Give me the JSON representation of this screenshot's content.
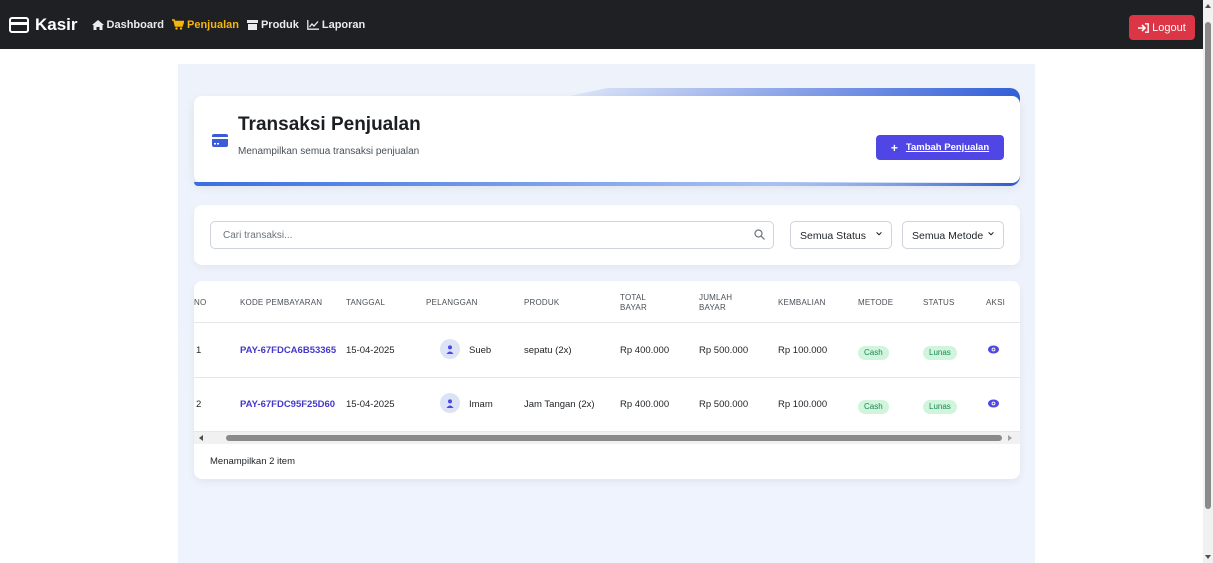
{
  "navbar": {
    "brand": "Kasir",
    "links": [
      {
        "label": "Dashboard",
        "icon": "home-icon",
        "active": false
      },
      {
        "label": "Penjualan",
        "icon": "cart-icon",
        "active": true
      },
      {
        "label": "Produk",
        "icon": "box-icon",
        "active": false
      },
      {
        "label": "Laporan",
        "icon": "chart-line-icon",
        "active": false
      }
    ],
    "logout_label": "Logout"
  },
  "header": {
    "title": "Transaksi Penjualan",
    "subtitle": "Menampilkan semua transaksi penjualan",
    "add_button": "Tambah Penjualan",
    "add_icon": "+"
  },
  "filters": {
    "search_placeholder": "Cari transaksi...",
    "status_value": "Semua Status",
    "metode_value": "Semua Metode"
  },
  "table": {
    "columns": [
      "NO",
      "KODE PEMBAYARAN",
      "TANGGAL",
      "PELANGGAN",
      "PRODUK",
      "TOTAL BAYAR",
      "JUMLAH BAYAR",
      "KEMBALIAN",
      "METODE",
      "STATUS",
      "AKSI"
    ],
    "rows": [
      {
        "no": "1",
        "kode": "PAY-67FDCA6B53365",
        "tanggal": "15-04-2025",
        "pelanggan": "Sueb",
        "produk": "sepatu (2x)",
        "total": "Rp 400.000",
        "jumlah": "Rp 500.000",
        "kembalian": "Rp 100.000",
        "metode": "Cash",
        "status": "Lunas"
      },
      {
        "no": "2",
        "kode": "PAY-67FDC95F25D60",
        "tanggal": "15-04-2025",
        "pelanggan": "Imam",
        "produk": "Jam Tangan (2x)",
        "total": "Rp 400.000",
        "jumlah": "Rp 500.000",
        "kembalian": "Rp 100.000",
        "metode": "Cash",
        "status": "Lunas"
      }
    ],
    "footer": "Menampilkan 2 item"
  },
  "colors": {
    "navbar_bg": "#1f2023",
    "active_link": "#f5b50a",
    "logout": "#dc3545",
    "primary": "#4f46e5",
    "badge_bg": "#d1f5dc",
    "badge_text": "#198754"
  }
}
